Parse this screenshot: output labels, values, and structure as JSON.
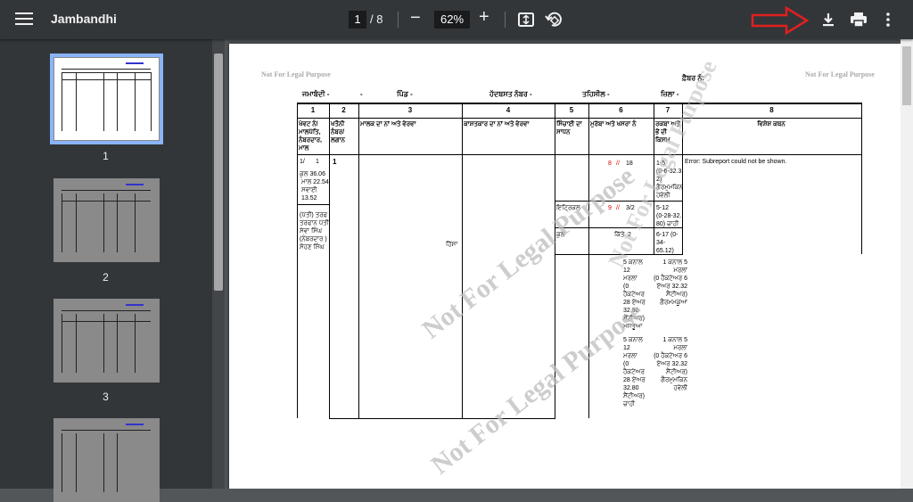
{
  "toolbar": {
    "title": "Jambandhi",
    "current_page": "1",
    "page_separator": "/ 8",
    "zoom": "62%",
    "zoom_out_icon": "−",
    "zoom_in_icon": "+"
  },
  "thumbnails": [
    {
      "label": "1"
    },
    {
      "label": "2"
    },
    {
      "label": "3"
    }
  ],
  "document": {
    "watermark_small": "Not For Legal Purpose",
    "watermark_large": "Not For Legal Purpose",
    "serial_label": "ਫ਼ੈਬਰ ਨੰ:",
    "header_fields": [
      "ਜਮਾਬੰਦੀ -",
      "-",
      "ਪਿੰਡ -",
      "ਹੱਦਬਸਤ ਨੰਬਰ -",
      "ਤਹਿਸੀਲ -",
      "ਜ਼ਿਲਾ -"
    ],
    "column_numbers": [
      "1",
      "2",
      "3",
      "4",
      "5",
      "6",
      "7",
      "8"
    ],
    "column_headers": [
      "ਖੇਵਟ ਨੰ/ ਮਾਲਪੱਤਿ, ਨੰਬਰਦਾਰ, ਮਾਲ",
      "ਖਤੌਨੀ ਨੰਬਰ/ ਲਗਾਨ",
      "ਮਾਲਕ ਦਾ ਨਾਂ ਅਤੇ ਵੇਰਵਾ",
      "ਕਾਸ਼ਤਕਾਰ ਦਾ ਨਾਂ ਅਤੇ ਵੇਰਵਾ",
      "ਸਿੰਚਾਈ ਦਾ ਸਾਧਨ",
      "ਮੁਰੱਬਾ ਅਤੇ ਖਸਰਾ ਨੰ",
      "ਰਕਬਾ ਅਤੇ ਭੋਂ ਦੀ ਕਿਸਮ",
      "ਵਿਸ਼ੇਸ਼ ਕਥਨ"
    ],
    "col1_values": [
      "1/",
      "1",
      "ਕੁਲ 36.06",
      "ਮਾਲ 22.54",
      "ਸਵਾਈ",
      "13.52",
      "(ਪੱਤੀ) ਤਰਫ",
      "ਤਰਫਾਨ ਪੱਤੀ",
      "ਸੇਵਾ ਸਿੰਘ",
      "(ਨੰਬਰਦਾਰ )",
      "ਸੋਹਣ ਸਿੰਘ"
    ],
    "col2_value": "1",
    "owner_note": "ਹਿੱਸਾ",
    "irrigation": [
      "ਇਟ੍ਰਿਕਲ",
      "ਕੁਲ"
    ],
    "khasra": [
      {
        "murabba": "8",
        "sep": "//",
        "khasra": "18"
      },
      {
        "murabba": "9",
        "sep": "//",
        "khasra": "3/2"
      },
      {
        "murabba": "ਕਿੱਤੇ",
        "sep": "",
        "khasra": "2"
      }
    ],
    "area": [
      [
        "1-5",
        "(0-6-32.3",
        "2)",
        "ਗੈਰਮੁਮਕਿਨ",
        "ਹਵੇਲੀ"
      ],
      [
        "5-12",
        "(0-28-32.",
        "80) ਚਾਹੀ"
      ],
      [
        "6-17 (0-",
        "34-",
        "65.12)"
      ]
    ],
    "remark": "Error: Subreport could not be shown.",
    "share_block1_left": [
      "5 ਕਨਾਲ",
      "12",
      "ਮਰਲਾ",
      "(0",
      "ਹੈਕਟੇਅਰ",
      "28 ਏਅਰ",
      "32.80",
      "ਸੈਂਟੀਅਰ)",
      "ਮਸਤੂਆ"
    ],
    "share_block1_right": [
      "1 ਕਨਾਲ 5",
      "ਮਰਲਾ",
      "(0 ਹੈਕਟੇਅਰ 6",
      "ਏਅਰ 32.32",
      "ਸੈਂਟੀਅਰ)",
      "ਗੈਰਮਮਕੂਆ"
    ],
    "share_block2_left": [
      "5 ਕਨਾਲ",
      "12",
      "ਮਰਲਾ",
      "(0",
      "ਹੈਕਟੇਅਰ",
      "28 ਏਅਰ",
      "32.80",
      "ਸੈਂਟੀਅਰ)",
      "ਚਾਹੀ"
    ],
    "share_block2_right": [
      "1 ਕਨਾਲ 5",
      "ਮਰਲਾ",
      "(0 ਹੈਕਟੇਅਰ 6",
      "ਏਅਰ 32.32",
      "ਸੈਂਟੀਅਰ)",
      "ਗੈਰਮੁਮਕਿਨ",
      "ਹਵੇਲੀ"
    ]
  }
}
